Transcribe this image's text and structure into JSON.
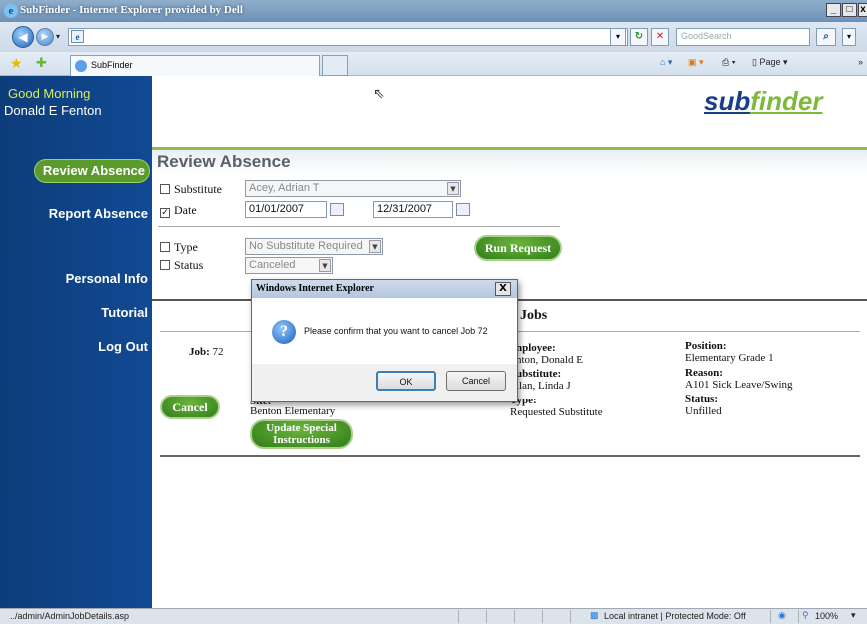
{
  "window": {
    "title": "SubFinder - Internet Explorer provided by Dell",
    "min": "_",
    "max": "□",
    "close": "x"
  },
  "browser": {
    "address": "",
    "search_placeholder": "GoodSearch",
    "tab_label": "SubFinder",
    "cmd_page": "Page"
  },
  "sidebar": {
    "greeting": "Good Morning",
    "user": "Donald E Fenton",
    "items": [
      {
        "label": "Report Absence"
      },
      {
        "label": "Review Absence"
      },
      {
        "label": "Personal Info"
      },
      {
        "label": "Tutorial"
      },
      {
        "label": "Log Out"
      }
    ]
  },
  "logo": {
    "part1": "sub",
    "part2": "finder"
  },
  "review": {
    "title": "Review Absence",
    "substitute_label": "Substitute",
    "substitute_value": "Acey, Adrian T",
    "date_label": "Date",
    "date_from": "01/01/2007",
    "date_to": "12/31/2007",
    "type_label": "Type",
    "type_value": "No Substitute Required",
    "status_label": "Status",
    "status_value": "Canceled",
    "run_button": "Run Request"
  },
  "jobs": {
    "heading": "Jobs",
    "job_label": "Job:",
    "job_number": "72",
    "cancel_button": "Cancel",
    "site_label": "Site:",
    "site_value": "Benton Elementary",
    "update_button_line1": "Update Special",
    "update_button_line2": "Instructions",
    "employee_label": "nployee:",
    "employee_value": "nton, Donald E",
    "substitute_label": "ubstitute:",
    "substitute_value": "llan, Linda J",
    "type_label": "Type:",
    "type_value": "Requested Substitute",
    "position_label": "Position:",
    "position_value": "Elementary Grade 1",
    "reason_label": "Reason:",
    "reason_value": "A101 Sick Leave/Swing",
    "status_label": "Status:",
    "status_value": "Unfilled"
  },
  "dialog": {
    "title": "Windows Internet Explorer",
    "message": "Please confirm that you want to cancel Job 72",
    "ok": "OK",
    "cancel": "Cancel",
    "close": "X"
  },
  "statusbar": {
    "url": "../admin/AdminJobDetails.asp",
    "zone": "Local intranet | Protected Mode: Off",
    "zoom": "100%"
  }
}
